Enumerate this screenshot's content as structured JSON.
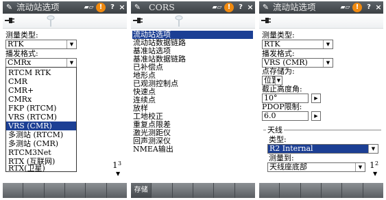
{
  "panel1": {
    "title": "流动站选项",
    "status_icons": {
      "battery": "battery-icon",
      "warning": "!",
      "help": "?",
      "close": "×"
    },
    "survey_type_label": "测量类型:",
    "survey_type_value": "RTK",
    "broadcast_format_label": "播发格式:",
    "broadcast_format_value": "CMRx",
    "dropdown_options": [
      "RTCM RTK",
      "CMR",
      "CMR+",
      "CMRx",
      "FKP (RTCM)",
      "VRS (RTCM)",
      "VRS (CMR)",
      "多测站 (RTCM)",
      "多测站 (CMR)",
      "RTCM3Net",
      "RTX (互联网)",
      "RTX(卫星)"
    ],
    "dropdown_selected_index": 6,
    "page_indicator": {
      "page": "1",
      "total": "3"
    }
  },
  "panel2": {
    "title": "CORS",
    "menu_items": [
      "流动站选项",
      "流动站数据链路",
      "基准站选项",
      "基准站数据链路",
      "已补偿点",
      "地形点",
      "已观测控制点",
      "快速点",
      "连续点",
      "放样",
      "工地校正",
      "重复点限差",
      "激光测距仪",
      "回声测深仪",
      "NMEA输出"
    ],
    "selected_index": 0,
    "softkeys": [
      "存储",
      "",
      "",
      "",
      "",
      ""
    ]
  },
  "panel3": {
    "title": "流动站选项",
    "survey_type_label": "测量类型:",
    "survey_type_value": "RTK",
    "broadcast_format_label": "播发格式:",
    "broadcast_format_value": "VRS (CMR)",
    "sat_diff_label": "点存储为:",
    "sat_diff_value": "位置",
    "elev_mask_label": "截止高度角:",
    "elev_mask_value": "10°",
    "pdop_label": "PDOP限制:",
    "pdop_value": "6.0",
    "antenna_group_label": "天线",
    "antenna_type_label": "类型:",
    "antenna_type_value": "R2 Internal",
    "measured_to_label": "测量到:",
    "measured_to_value": "天线座底部",
    "page_indicator": {
      "page": "1",
      "total": "2"
    }
  },
  "colors": {
    "selection": "#1c3f94",
    "titlebar": "#4a4f53",
    "warning": "#f08a10"
  }
}
